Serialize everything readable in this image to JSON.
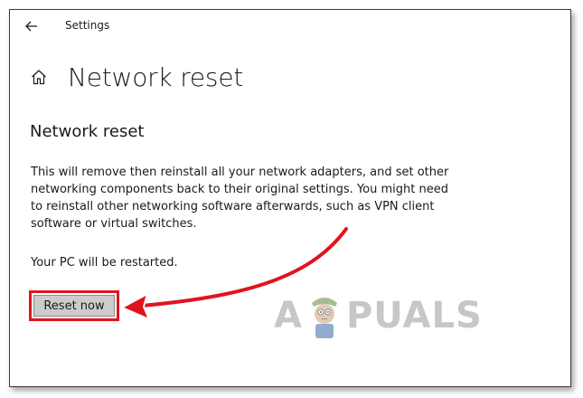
{
  "window": {
    "app_title": "Settings"
  },
  "header": {
    "back_icon": "back-arrow-icon",
    "home_icon": "home-icon",
    "page_title": "Network reset"
  },
  "content": {
    "section_title": "Network reset",
    "description": "This will remove then reinstall all your network adapters, and set other networking components back to their original settings. You might need to reinstall other networking software afterwards, such as VPN client software or virtual switches.",
    "restart_note": "Your PC will be restarted.",
    "reset_button_label": "Reset now"
  },
  "annotation": {
    "highlight_color": "#e0141e",
    "arrow_color": "#e0141e"
  },
  "watermark": {
    "text_left": "A",
    "text_right": "PUALS"
  }
}
